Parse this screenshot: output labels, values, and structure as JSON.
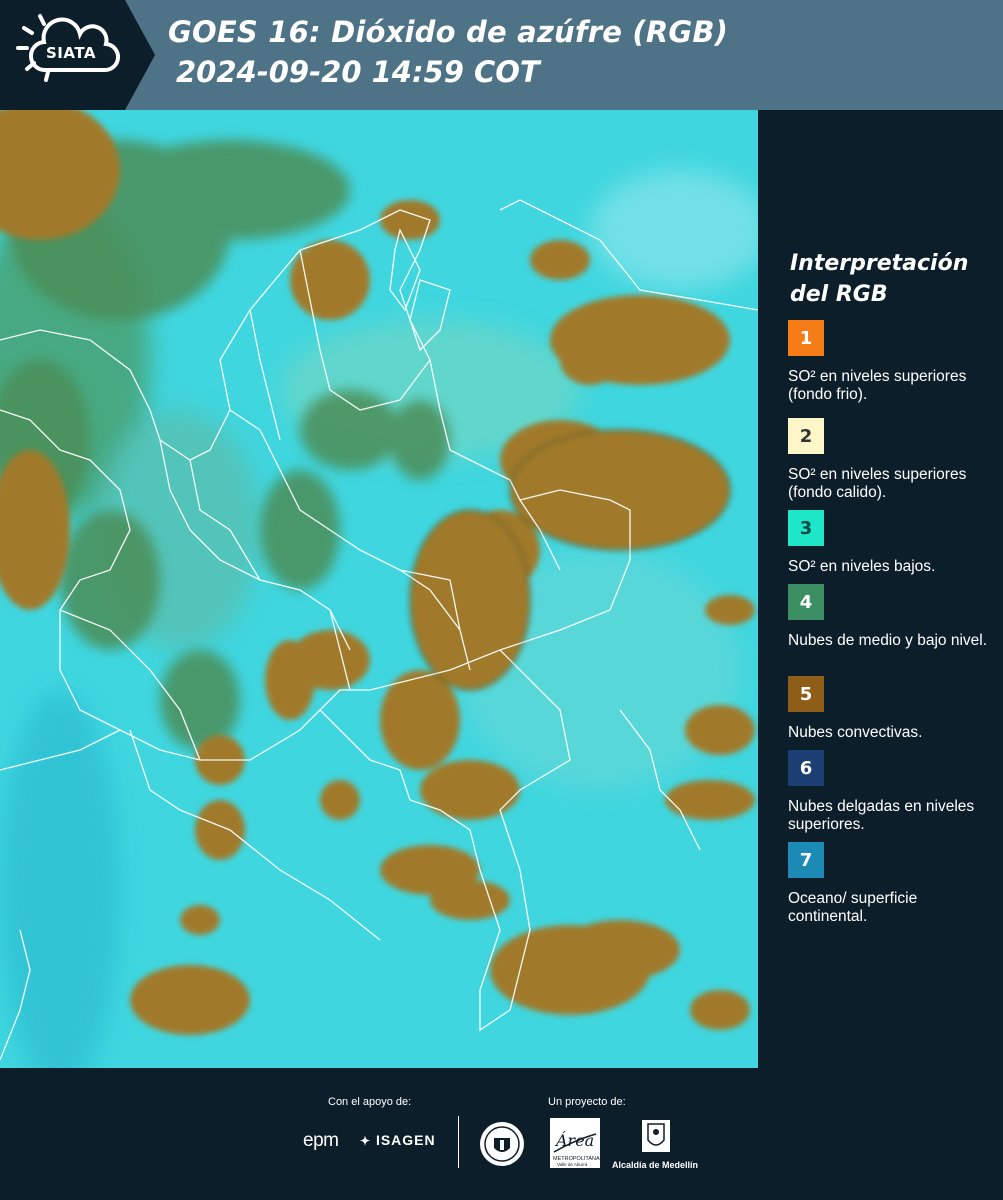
{
  "header": {
    "title": "GOES 16: Dióxido de azúfre (RGB)",
    "subtitle": "2024-09-20 14:59 COT",
    "logo_text": "SIATA",
    "background_color": "#4e7286"
  },
  "map": {
    "subject": "Colombia and northern South America satellite RGB composite",
    "background_color": "#36d4dd",
    "cloud_color": "#a4782a",
    "border_color": "#ffffff"
  },
  "legend": {
    "title_line1": "Interpretación",
    "title_line2": "del RGB",
    "items": [
      {
        "number": "1",
        "label": "SO² en niveles superiores (fondo frio).",
        "color": "#f57c16",
        "text_color": "#ffffff"
      },
      {
        "number": "2",
        "label": "SO² en niveles superiores (fondo calido).",
        "color": "#fdf6c8",
        "text_color": "#333333"
      },
      {
        "number": "3",
        "label": "SO² en niveles bajos.",
        "color": "#1ee6c9",
        "text_color": "#0b4b48"
      },
      {
        "number": "4",
        "label": "Nubes de medio y bajo nivel.",
        "color": "#3c8f63",
        "text_color": "#ffffff"
      },
      {
        "number": "5",
        "label": "Nubes convectivas.",
        "color": "#8e5e18",
        "text_color": "#ffffff"
      },
      {
        "number": "6",
        "label": "Nubes delgadas en niveles superiores.",
        "color": "#1c3f73",
        "text_color": "#ffffff"
      },
      {
        "number": "7",
        "label": "Oceano/ superficie continental.",
        "color": "#1b8ab4",
        "text_color": "#ffffff"
      }
    ]
  },
  "footer": {
    "support_label": "Con el apoyo de:",
    "project_label": "Un proyecto de:",
    "epm": "epm",
    "isagen": "ISAGEN",
    "area_text": "Área",
    "area_subtext": "METROPOLITANA",
    "area_subtext2": "Valle de Aburrá",
    "alcaldia": "Alcaldía de Medellín"
  }
}
